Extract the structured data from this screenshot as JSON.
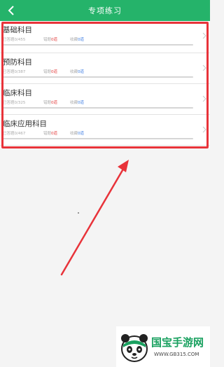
{
  "header": {
    "title": "专项练习",
    "background": "#25b36a"
  },
  "icons": {
    "back": "chevron-left-icon",
    "row_chevron": "chevron-right-icon"
  },
  "subjects": [
    {
      "title": "基础科目",
      "progress_label": "已答题0/455",
      "wrong_label": "错题",
      "wrong_count": "0道",
      "fav_label": "收藏",
      "fav_count": "0道",
      "progress": 0
    },
    {
      "title": "预防科目",
      "progress_label": "已答题0/387",
      "wrong_label": "错题",
      "wrong_count": "0道",
      "fav_label": "收藏",
      "fav_count": "0道",
      "progress": 0
    },
    {
      "title": "临床科目",
      "progress_label": "已答题0/325",
      "wrong_label": "错题",
      "wrong_count": "0道",
      "fav_label": "收藏",
      "fav_count": "0道",
      "progress": 0
    },
    {
      "title": "临床应用科目",
      "progress_label": "已答题0/467",
      "wrong_label": "错题",
      "wrong_count": "0道",
      "fav_label": "收藏",
      "fav_count": "0道",
      "progress": 0
    }
  ],
  "colors": {
    "accent": "#25b36a",
    "wrong": "#e23a3a",
    "favorite": "#3a7be2",
    "annotation": "#e8333a"
  },
  "watermark": {
    "name": "国宝手游网",
    "url": "WWW.GB315.COM"
  }
}
